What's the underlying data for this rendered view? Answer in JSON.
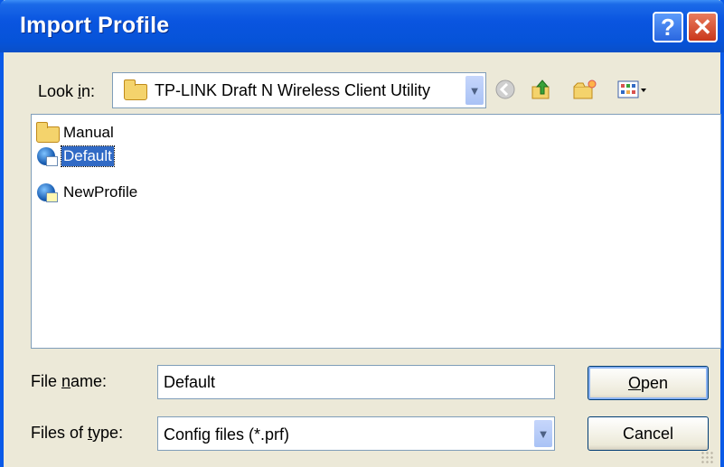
{
  "window": {
    "title": "Import Profile",
    "help_glyph": "?",
    "close_glyph": "✕"
  },
  "lookin": {
    "label_pre": "Look ",
    "label_u": "i",
    "label_post": "n:",
    "value": "TP-LINK Draft N Wireless Client Utility"
  },
  "toolbar": [
    "back-icon",
    "up-folder-icon",
    "new-folder-icon",
    "view-menu-icon"
  ],
  "files": [
    {
      "name": "Manual",
      "icon": "folder-icon",
      "selected": false
    },
    {
      "name": "Default",
      "icon": "network-profile-icon",
      "selected": true
    },
    {
      "name": "NewProfile",
      "icon": "network-profile-icon",
      "selected": false
    }
  ],
  "filename": {
    "label_pre": "File ",
    "label_u": "n",
    "label_post": "ame:",
    "value": "Default"
  },
  "filetype": {
    "label_pre": "Files of ",
    "label_u": "t",
    "label_post": "ype:",
    "value": "Config files (*.prf)"
  },
  "buttons": {
    "open_u": "O",
    "open_rest": "pen",
    "cancel": "Cancel"
  },
  "colors": {
    "title_bar": "#0a55e0",
    "selection": "#316ac5",
    "dialog_bg": "#ece9d8"
  }
}
